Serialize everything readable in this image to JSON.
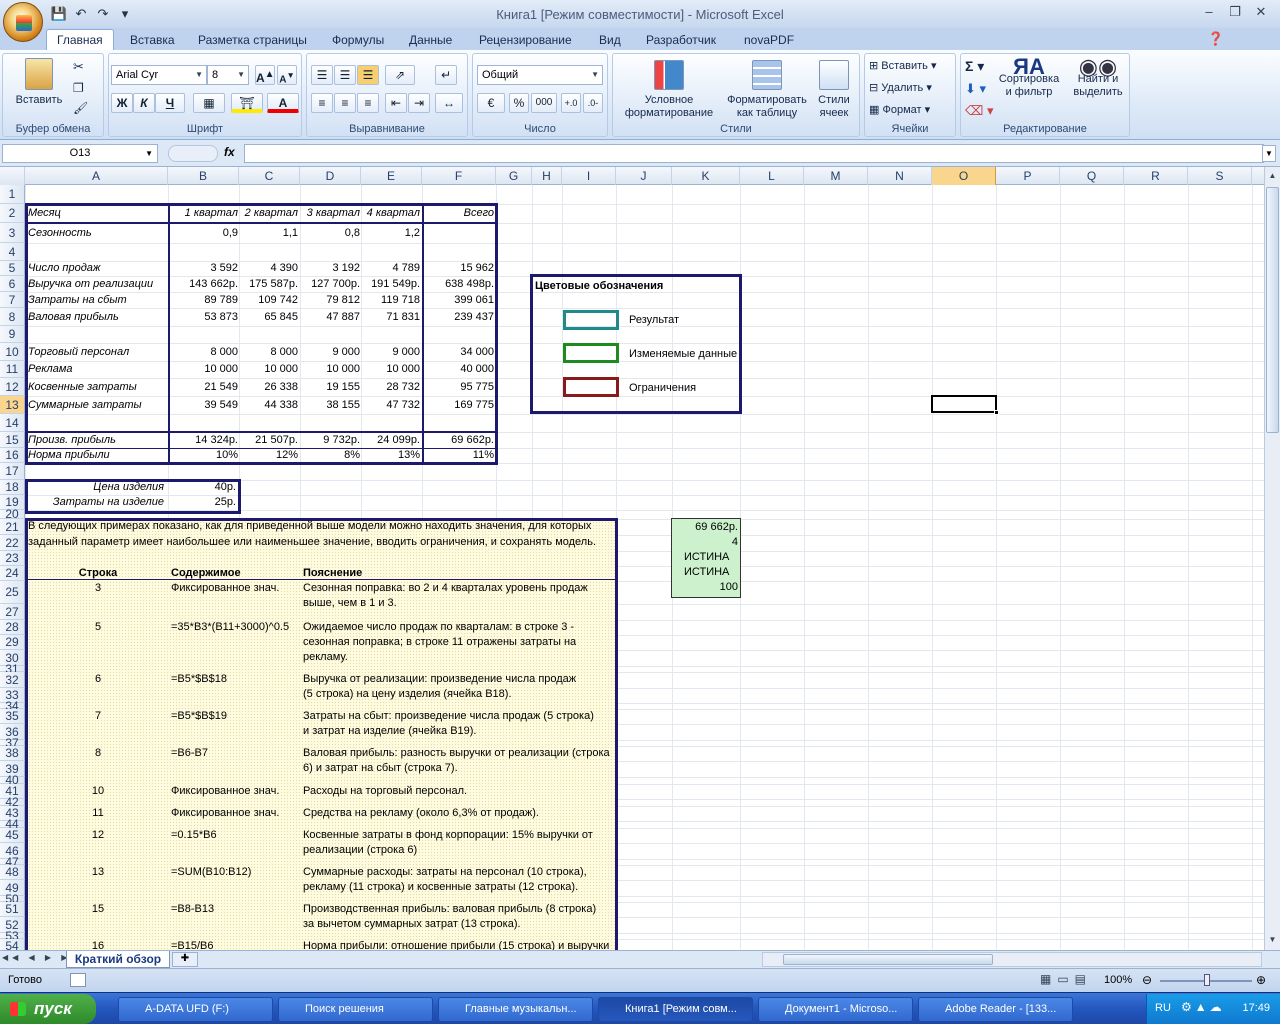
{
  "window": {
    "title": "Книга1  [Режим совместимости] - Microsoft Excel"
  },
  "tabs": [
    "Главная",
    "Вставка",
    "Разметка страницы",
    "Формулы",
    "Данные",
    "Рецензирование",
    "Вид",
    "Разработчик",
    "novaPDF"
  ],
  "ribbon": {
    "clipboard": {
      "label": "Буфер обмена",
      "paste": "Вставить"
    },
    "font": {
      "label": "Шрифт",
      "name": "Arial Cyr",
      "size": "8",
      "bold": "Ж",
      "italic": "К",
      "underline": "Ч"
    },
    "alignment": {
      "label": "Выравнивание"
    },
    "number": {
      "label": "Число",
      "format": "Общий",
      "percent": "%",
      "thousands": "000"
    },
    "styles": {
      "label": "Стили",
      "cond1": "Условное",
      "cond2": "форматирование",
      "table1": "Форматировать",
      "table2": "как таблицу",
      "cell1": "Стили",
      "cell2": "ячеек"
    },
    "cells": {
      "label": "Ячейки",
      "insert": "Вставить",
      "delete": "Удалить",
      "format": "Формат"
    },
    "editing": {
      "label": "Редактирование",
      "sort1": "Сортировка",
      "sort2": "и фильтр",
      "find1": "Найти и",
      "find2": "выделить"
    }
  },
  "formula_bar": {
    "name_box": "O13",
    "fx": "fx",
    "formula": ""
  },
  "columns": [
    "A",
    "B",
    "C",
    "D",
    "E",
    "F",
    "G",
    "H",
    "I",
    "J",
    "K",
    "L",
    "M",
    "N",
    "O",
    "P",
    "Q",
    "R",
    "S"
  ],
  "rows": [
    "1",
    "2",
    "3",
    "4",
    "5",
    "6",
    "7",
    "8",
    "9",
    "10",
    "11",
    "12",
    "13",
    "14",
    "15",
    "16",
    "17",
    "18",
    "19",
    "20",
    "21",
    "22",
    "23",
    "24",
    "25",
    "27",
    "28",
    "29",
    "30",
    "31",
    "32",
    "33",
    "34",
    "35",
    "36",
    "37",
    "38",
    "39",
    "40",
    "41",
    "42",
    "43",
    "44",
    "45",
    "46",
    "47",
    "48",
    "49",
    "50",
    "51",
    "52",
    "53",
    "54"
  ],
  "model": {
    "headers": [
      "Месяц",
      "1 квартал",
      "2 квартал",
      "3 квартал",
      "4 квартал",
      "Всего"
    ],
    "season": {
      "label": "Сезонность",
      "values": [
        "0,9",
        "1,1",
        "0,8",
        "1,2"
      ]
    },
    "block1": [
      {
        "label": "Число продаж",
        "values": [
          "3 592",
          "4 390",
          "3 192",
          "4 789",
          "15 962"
        ]
      },
      {
        "label": "Выручка от реализации",
        "values": [
          "143 662р.",
          "175 587р.",
          "127 700р.",
          "191 549р.",
          "638 498р."
        ]
      },
      {
        "label": "Затраты на сбыт",
        "values": [
          "89 789",
          "109 742",
          "79 812",
          "119 718",
          "399 061"
        ]
      },
      {
        "label": "Валовая прибыль",
        "values": [
          "53 873",
          "65 845",
          "47 887",
          "71 831",
          "239 437"
        ]
      }
    ],
    "block2": [
      {
        "label": "Торговый персонал",
        "values": [
          "8 000",
          "8 000",
          "9 000",
          "9 000",
          "34 000"
        ]
      },
      {
        "label": "Реклама",
        "values": [
          "10 000",
          "10 000",
          "10 000",
          "10 000",
          "40 000"
        ]
      },
      {
        "label": "Косвенные затраты",
        "values": [
          "21 549",
          "26 338",
          "19 155",
          "28 732",
          "95 775"
        ]
      },
      {
        "label": "Суммарные затраты",
        "values": [
          "39 549",
          "44 338",
          "38 155",
          "47 732",
          "169 775"
        ]
      }
    ],
    "profit": {
      "label": "Произв. прибыль",
      "values": [
        "14 324р.",
        "21 507р.",
        "9 732р.",
        "24 099р.",
        "69 662р."
      ]
    },
    "margin": {
      "label": "Норма прибыли",
      "values": [
        "10%",
        "12%",
        "8%",
        "13%",
        "11%"
      ]
    }
  },
  "params": [
    {
      "label": "Цена изделия",
      "value": "40р."
    },
    {
      "label": "Затраты на изделие",
      "value": "25р."
    }
  ],
  "legend": {
    "title": "Цветовые обозначения",
    "items": [
      {
        "label": "Результат",
        "color": "#1e8a8a"
      },
      {
        "label": "Изменяемые данные",
        "color": "#1f8a1f"
      },
      {
        "label": "Ограничения",
        "color": "#8a1a1a"
      }
    ]
  },
  "solver": [
    "69 662р.",
    "4",
    "ИСТИНА",
    "ИСТИНА",
    "100"
  ],
  "notes": {
    "intro1": "В следующих примерах показано, как для приведенной выше модели можно находить значения, для которых",
    "intro2": "заданный параметр имеет наибольшее или наименьшее значение, вводить ограничения, и сохранять модель.",
    "headers": [
      "Строка",
      "Содержимое",
      "Пояснение"
    ],
    "rows": [
      {
        "row": "3",
        "content": "Фиксированное знач.",
        "lines": [
          "Сезонная поправка:  во 2 и 4 кварталах уровень продаж",
          "выше, чем в 1 и 3."
        ]
      },
      {
        "row": "5",
        "content": "=35*B3*(B11+3000)^0.5",
        "lines": [
          "Ожидаемое число продаж по кварталам:  в строке 3 -",
          "сезонная поправка; в строке 11 отражены затраты на",
          "рекламу."
        ]
      },
      {
        "row": "6",
        "content": "=B5*$B$18",
        "lines": [
          "Выручка от реализации:  произведение числа продаж",
          "(5 строка) на цену изделия (ячейка B18)."
        ]
      },
      {
        "row": "7",
        "content": "=B5*$B$19",
        "lines": [
          "Затраты на сбыт:  произведение числа продаж (5 строка)",
          "и затрат на изделие (ячейка B19)."
        ]
      },
      {
        "row": "8",
        "content": "=B6-B7",
        "lines": [
          "Валовая прибыль:  разность выручки от реализации (строка",
          " 6) и затрат на сбыт (строка 7)."
        ]
      },
      {
        "row": "10",
        "content": "Фиксированное знач.",
        "lines": [
          "Расходы на торговый персонал."
        ]
      },
      {
        "row": "11",
        "content": "Фиксированное знач.",
        "lines": [
          "Средства на рекламу (около 6,3% от продаж)."
        ]
      },
      {
        "row": "12",
        "content": "=0.15*B6",
        "lines": [
          "Косвенные затраты в фонд корпорации:  15% выручки от",
          "реализации (строка 6)"
        ]
      },
      {
        "row": "13",
        "content": "=SUM(B10:B12)",
        "lines": [
          "Суммарные расходы:  затраты на персонал (10 строка),",
          "рекламу (11 строка) и косвенные затраты (12 строка)."
        ]
      },
      {
        "row": "15",
        "content": "=B8-B13",
        "lines": [
          "Производственная прибыль:  валовая прибыль (8 строка)",
          "за вычетом суммарных затрат (13 строка)."
        ]
      },
      {
        "row": "16",
        "content": "=B15/B6",
        "lines": [
          "Норма прибыли:  отношение прибыли (15 строка) и выручки"
        ]
      }
    ]
  },
  "sheet_tab": "Краткий обзор",
  "status": {
    "ready": "Готово",
    "zoom": "100%"
  },
  "taskbar": {
    "start": "пуск",
    "items": [
      "A-DATA UFD (F:)",
      "Поиск решения",
      "Главные музыкальн...",
      "Книга1  [Режим совм...",
      "Документ1 - Microso...",
      "Adobe Reader - [133..."
    ],
    "lang": "RU",
    "clock": "17:49"
  }
}
